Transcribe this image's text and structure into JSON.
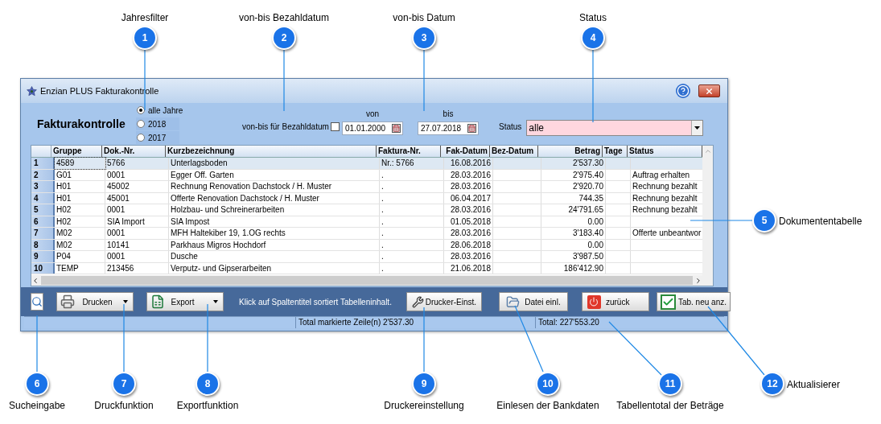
{
  "window": {
    "title": "Enzian PLUS Fakturakontrolle"
  },
  "header": {
    "title": "Fakturakontrolle",
    "year_filter": [
      {
        "label": "alle Jahre",
        "selected": true
      },
      {
        "label": "2018",
        "selected": false
      },
      {
        "label": "2017",
        "selected": false
      }
    ],
    "paid_date_checkbox": {
      "label": "von-bis für Bezahldatum",
      "checked": false
    },
    "from": {
      "label": "von",
      "value": "01.01.2000"
    },
    "to": {
      "label": "bis",
      "value": "27.07.2018"
    },
    "status": {
      "label": "Status",
      "value": "alle"
    }
  },
  "table": {
    "columns": [
      "Gruppe",
      "Dok.-Nr.",
      "Kurzbezeichnung",
      "Faktura-Nr.",
      "Fak-Datum",
      "Bez-Datum",
      "Betrag",
      "Tage",
      "Status"
    ],
    "rows": [
      {
        "number": "1",
        "selected": true,
        "cells": [
          "4589",
          "5766",
          "Unterlagsboden",
          "Nr.: 5766",
          "16.08.2016",
          "",
          "2'537.30",
          "",
          ""
        ]
      },
      {
        "number": "2",
        "selected": false,
        "cells": [
          "G01",
          "0001",
          "Egger Off. Garten",
          ".",
          "28.03.2016",
          "",
          "2'975.40",
          "",
          "Auftrag erhalten"
        ]
      },
      {
        "number": "3",
        "selected": false,
        "cells": [
          "H01",
          "45002",
          "Rechnung Renovation Dachstock / H. Muster",
          ".",
          "28.03.2016",
          "",
          "2'920.70",
          "",
          "Rechnung bezahlt"
        ]
      },
      {
        "number": "4",
        "selected": false,
        "cells": [
          "H01",
          "45001",
          "Offerte Renovation Dachstock / H. Muster",
          ".",
          "06.04.2017",
          "",
          "744.35",
          "",
          "Rechnung bezahlt"
        ]
      },
      {
        "number": "5",
        "selected": false,
        "cells": [
          "H02",
          "0001",
          "Holzbau- und Schreinerarbeiten",
          ".",
          "28.03.2016",
          "",
          "24'791.65",
          "",
          "Rechnung bezahlt"
        ]
      },
      {
        "number": "6",
        "selected": false,
        "cells": [
          "H02",
          "SIA Import",
          "SIA Impost",
          ".",
          "01.05.2018",
          "",
          "0.00",
          "",
          ""
        ]
      },
      {
        "number": "7",
        "selected": false,
        "cells": [
          "M02",
          "0001",
          "MFH Haltekiber 19, 1.OG rechts",
          ".",
          "28.03.2016",
          "",
          "3'183.40",
          "",
          "Offerte unbeantwor"
        ]
      },
      {
        "number": "8",
        "selected": false,
        "cells": [
          "M02",
          "10141",
          "Parkhaus Migros Hochdorf",
          ".",
          "28.06.2018",
          "",
          "0.00",
          "",
          ""
        ]
      },
      {
        "number": "9",
        "selected": false,
        "cells": [
          "P04",
          "0001",
          "Dusche",
          ".",
          "28.03.2016",
          "",
          "3'987.50",
          "",
          ""
        ]
      },
      {
        "number": "10",
        "selected": false,
        "cells": [
          "TEMP",
          "213456",
          "Verputz- und Gipserarbeiten",
          ".",
          "21.06.2018",
          "",
          "186'412.90",
          "",
          ""
        ]
      }
    ]
  },
  "toolbar": {
    "buttons": [
      {
        "kind": "search"
      },
      {
        "kind": "print",
        "label": "Drucken"
      },
      {
        "kind": "export",
        "label": "Export"
      },
      {
        "kind": "hint",
        "label": "Klick auf Spaltentitel sortiert Tabelleninhalt."
      },
      {
        "kind": "printer_setup",
        "label": "Drucker-Einst."
      },
      {
        "kind": "import",
        "label": "Datei einl."
      },
      {
        "kind": "back",
        "label": "zurück"
      },
      {
        "kind": "refresh",
        "label": "Tab. neu anz."
      }
    ]
  },
  "status_bar": {
    "marked_total": "Total markierte Zeile(n)  2'537.30",
    "total": "Total:  227'553.20"
  },
  "callouts": [
    {
      "number": "1",
      "label": "Jahresfilter"
    },
    {
      "number": "2",
      "label": "von-bis Bezahldatum"
    },
    {
      "number": "3",
      "label": "von-bis Datum"
    },
    {
      "number": "4",
      "label": "Status"
    },
    {
      "number": "5",
      "label": "Dokumententabelle"
    },
    {
      "number": "6",
      "label": "Sucheingabe"
    },
    {
      "number": "7",
      "label": "Druckfunktion"
    },
    {
      "number": "8",
      "label": "Exportfunktion"
    },
    {
      "number": "9",
      "label": "Druckereinstellung"
    },
    {
      "number": "10",
      "label": "Einlesen der Bankdaten"
    },
    {
      "number": "11",
      "label": "Tabellentotal der Beträge"
    },
    {
      "number": "12",
      "label": "Aktualisierer"
    }
  ]
}
